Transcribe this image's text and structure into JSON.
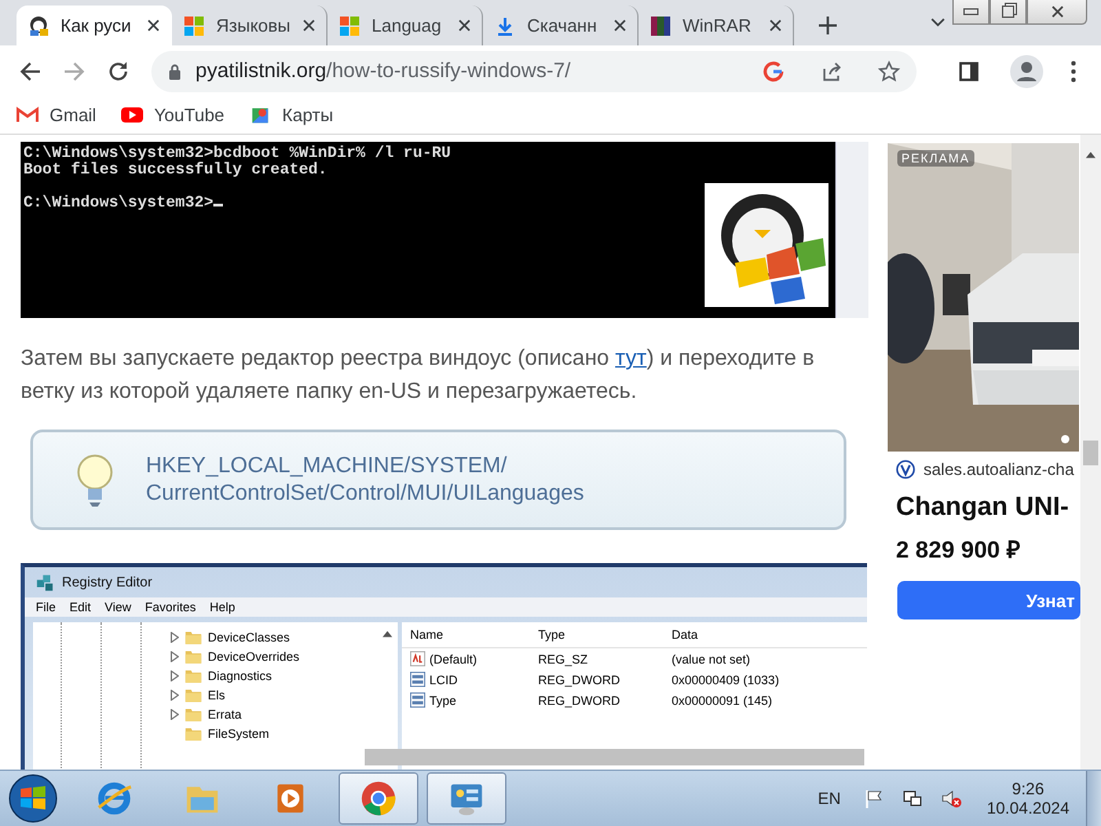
{
  "browser": {
    "tabs": [
      {
        "title": "Как руси",
        "kind": "site",
        "selected": true
      },
      {
        "title": "Языковы",
        "kind": "windows",
        "selected": false
      },
      {
        "title": "Languag",
        "kind": "windows",
        "selected": false
      },
      {
        "title": "Скачанн",
        "kind": "download",
        "selected": false
      },
      {
        "title": "WinRAR",
        "kind": "winrar",
        "selected": false
      }
    ],
    "address": {
      "domain": "pyatilistnik.org",
      "path": "/how-to-russify-windows-7/"
    },
    "bookmarks": [
      {
        "label": "Gmail",
        "kind": "gmail"
      },
      {
        "label": "YouTube",
        "kind": "youtube"
      },
      {
        "label": "Карты",
        "kind": "maps"
      }
    ]
  },
  "article": {
    "console_blocks": [
      [
        "C:\\Windows\\system32>bcdboot %WinDir% /l ru-RU",
        "Boot files successfully created."
      ],
      [
        "C:\\Windows\\system32>"
      ]
    ],
    "paragraph": {
      "before": "Затем вы запускаете редактор реестра виндоус (описано ",
      "link": "тут",
      "after": ") и переходите в ветку из которой удаляете папку en-US и перезагружаетесь."
    },
    "registry_path": [
      "HKEY_LOCAL_MACHINE/SYSTEM/",
      "CurrentControlSet/Control/MUI/UILanguages"
    ],
    "registry_editor": {
      "title": "Registry Editor",
      "menu": [
        "File",
        "Edit",
        "View",
        "Favorites",
        "Help"
      ],
      "tree": [
        {
          "label": "DeviceClasses",
          "expandable": true
        },
        {
          "label": "DeviceOverrides",
          "expandable": true
        },
        {
          "label": "Diagnostics",
          "expandable": true
        },
        {
          "label": "Els",
          "expandable": true
        },
        {
          "label": "Errata",
          "expandable": true
        },
        {
          "label": "FileSystem",
          "expandable": false
        }
      ],
      "columns": [
        "Name",
        "Type",
        "Data"
      ],
      "values": [
        {
          "name": "(Default)",
          "type": "REG_SZ",
          "data": "(value not set)",
          "kind": "string"
        },
        {
          "name": "LCID",
          "type": "REG_DWORD",
          "data": "0x00000409 (1033)",
          "kind": "binary"
        },
        {
          "name": "Type",
          "type": "REG_DWORD",
          "data": "0x00000091 (145)",
          "kind": "binary"
        }
      ]
    }
  },
  "ad": {
    "label": "РЕКЛАМА",
    "domain": "sales.autoalianz-cha",
    "title": "Changan UNI-",
    "price": "2 829 900 ₽",
    "button": "Узнат"
  },
  "taskbar": {
    "items": [
      {
        "kind": "ie",
        "selected": false
      },
      {
        "kind": "explorer",
        "selected": false
      },
      {
        "kind": "media",
        "selected": false
      },
      {
        "kind": "chrome",
        "selected": true
      },
      {
        "kind": "regedit",
        "selected": true
      }
    ],
    "language": "EN",
    "time": "9:26",
    "date": "10.04.2024"
  }
}
